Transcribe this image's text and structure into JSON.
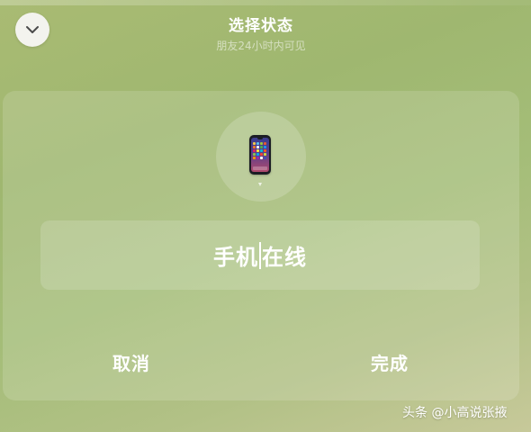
{
  "header": {
    "title": "选择状态",
    "subtitle": "朋友24小时内可见"
  },
  "status": {
    "icon": "smartphone-icon",
    "text_before_cursor": "手机",
    "text_after_cursor": "在线"
  },
  "actions": {
    "cancel_label": "取消",
    "done_label": "完成"
  },
  "watermark": {
    "text": "头条 @小高说张掖"
  },
  "colors": {
    "background_green": "#a4bd78",
    "text": "#ffffff",
    "collapse_button": "#f3f3ee"
  }
}
